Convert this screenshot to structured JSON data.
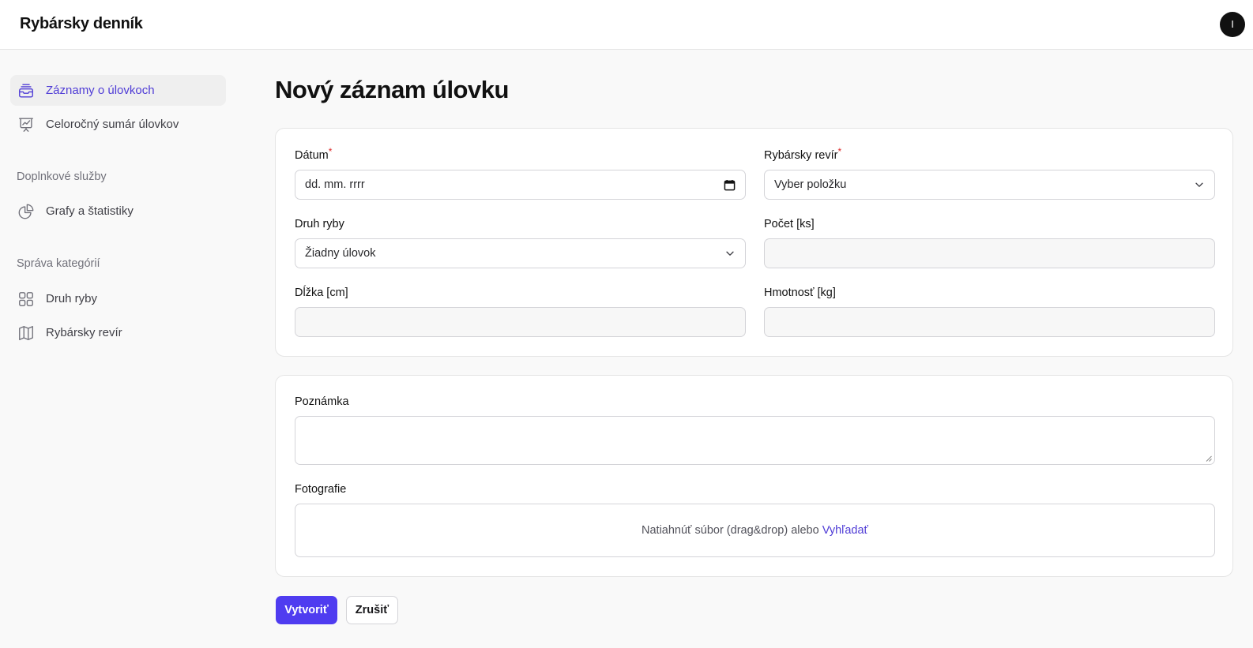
{
  "app": {
    "title": "Rybársky denník",
    "avatar_initial": "I"
  },
  "sidebar": {
    "items": [
      {
        "label": "Záznamy o úlovkoch",
        "icon": "inbox-stack-icon",
        "active": true
      },
      {
        "label": "Celoročný sumár úlovkov",
        "icon": "presentation-chart-icon",
        "active": false
      }
    ],
    "groups": [
      {
        "label": "Doplnkové služby",
        "items": [
          {
            "label": "Grafy a štatistiky",
            "icon": "pie-chart-icon"
          }
        ]
      },
      {
        "label": "Správa kategórií",
        "items": [
          {
            "label": "Druh ryby",
            "icon": "grid-icon"
          },
          {
            "label": "Rybársky revír",
            "icon": "map-icon"
          }
        ]
      }
    ]
  },
  "page": {
    "title": "Nový záznam úlovku"
  },
  "form": {
    "date": {
      "label": "Dátum",
      "required_mark": "*",
      "placeholder": "dd. mm. rrrr"
    },
    "revir": {
      "label": "Rybársky revír",
      "required_mark": "*",
      "value": "Vyber položku"
    },
    "druh": {
      "label": "Druh ryby",
      "value": "Žiadny úlovok"
    },
    "pocet": {
      "label": "Počet [ks]",
      "value": ""
    },
    "dlzka": {
      "label": "Dĺžka [cm]",
      "value": ""
    },
    "hmotnost": {
      "label": "Hmotnosť [kg]",
      "value": ""
    },
    "poznamka": {
      "label": "Poznámka",
      "value": ""
    },
    "foto": {
      "label": "Fotografie",
      "drop_text": "Natiahnúť súbor (drag&drop) alebo",
      "browse_link": "Vyhľadať"
    }
  },
  "actions": {
    "create": "Vytvoriť",
    "cancel": "Zrušiť"
  },
  "colors": {
    "accent": "#4f3cf0",
    "accent_text": "#4f3cd6",
    "required": "#dc2626"
  }
}
